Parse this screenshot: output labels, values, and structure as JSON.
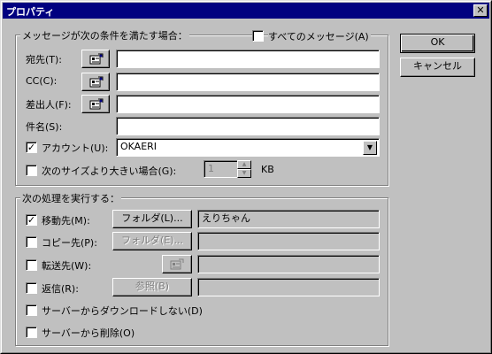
{
  "window": {
    "title": "プロパティ",
    "close_glyph": "✕"
  },
  "buttons": {
    "ok": "OK",
    "cancel": "キャンセル"
  },
  "conditions": {
    "group_label": "メッセージが次の条件を満たす場合：",
    "all_messages": {
      "label": "すべてのメッセージ(A)",
      "checked": false
    },
    "to": {
      "label": "宛先(T):",
      "value": ""
    },
    "cc": {
      "label": "CC(C):",
      "value": ""
    },
    "from": {
      "label": "差出人(F):",
      "value": ""
    },
    "subject": {
      "label": "件名(S):",
      "value": ""
    },
    "account": {
      "label": "アカウント(U):",
      "checked": true,
      "value": "OKAERI"
    },
    "size": {
      "label": "次のサイズより大きい場合(G):",
      "checked": false,
      "value": "1",
      "unit": "KB"
    }
  },
  "actions": {
    "group_label": "次の処理を実行する：",
    "move": {
      "label": "移動先(M):",
      "checked": true,
      "button": "フォルダ(L)...",
      "value": "えりちゃん"
    },
    "copy": {
      "label": "コピー先(P):",
      "checked": false,
      "button": "フォルダ(E)...",
      "value": ""
    },
    "forward": {
      "label": "転送先(W):",
      "checked": false,
      "value": ""
    },
    "reply": {
      "label": "返信(R):",
      "checked": false,
      "button": "参照(B)",
      "value": ""
    },
    "no_download": {
      "label": "サーバーからダウンロードしない(D)",
      "checked": false
    },
    "delete_server": {
      "label": "サーバーから削除(O)",
      "checked": false
    }
  },
  "colors": {
    "titlebar": "#000080",
    "face": "#c0c0c0",
    "disabled_text": "#808080"
  },
  "icons": {
    "address_book": "address-book-icon",
    "check": "✓"
  }
}
